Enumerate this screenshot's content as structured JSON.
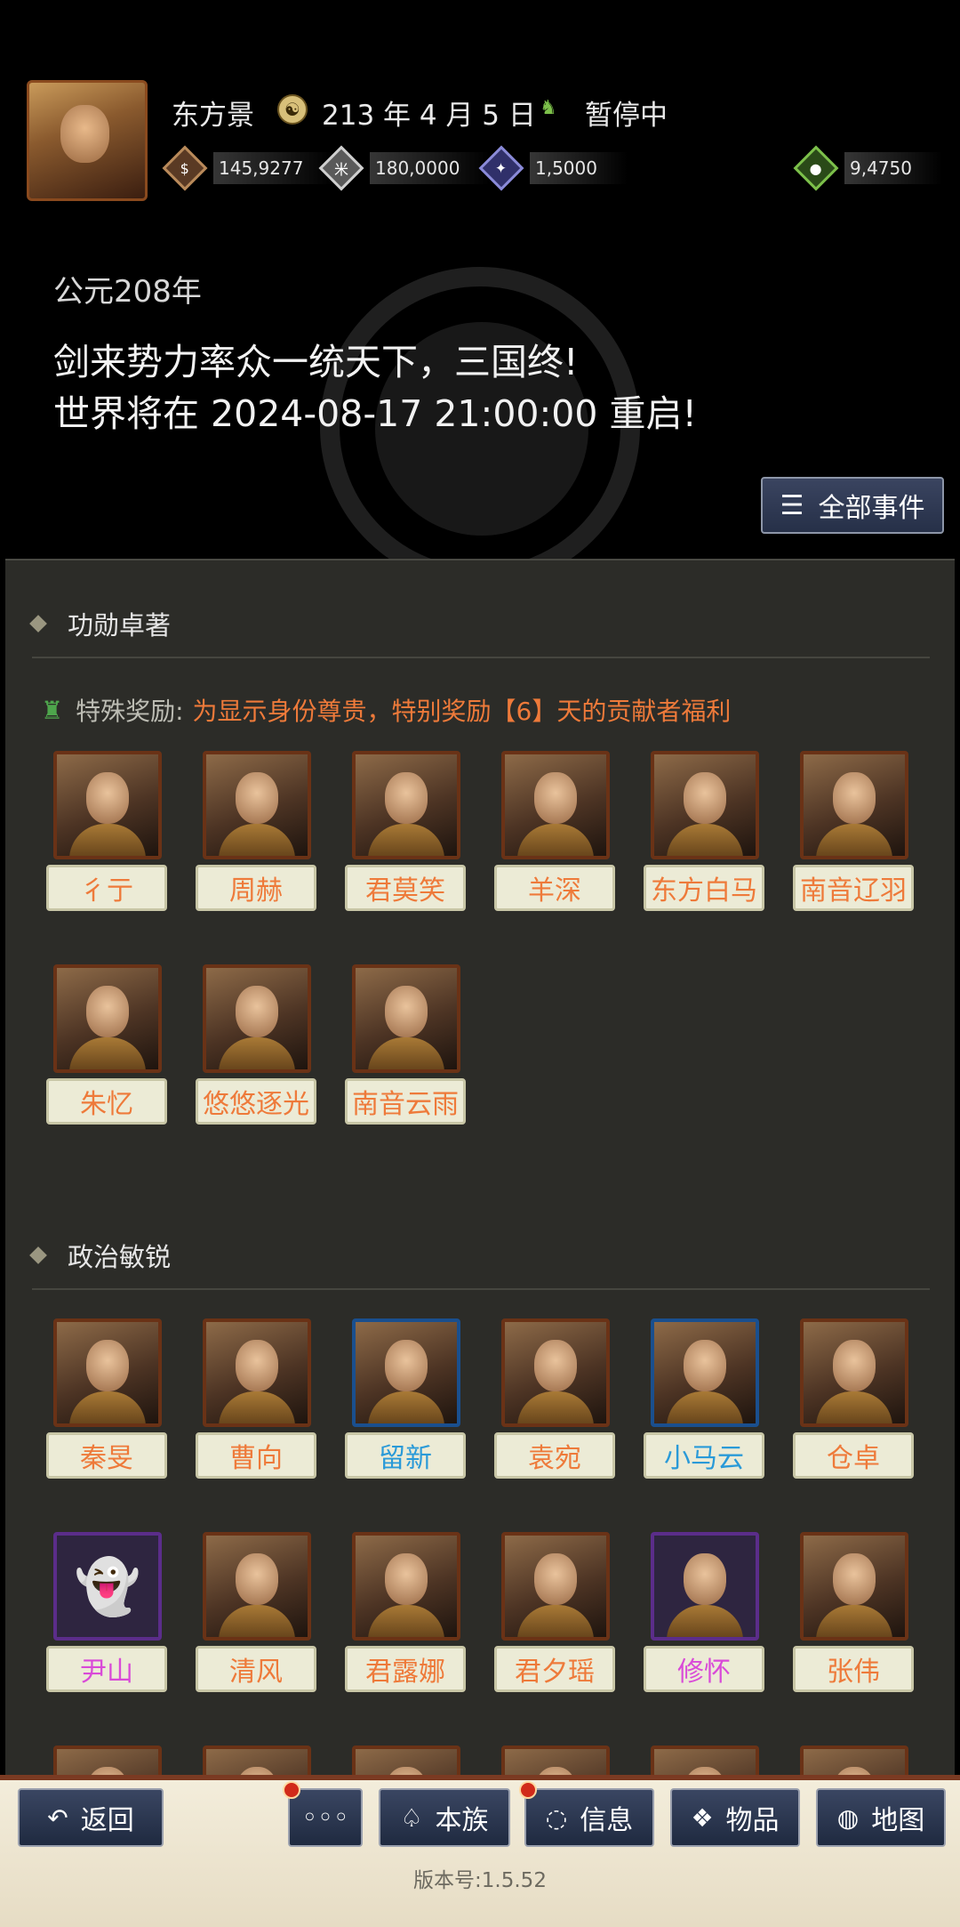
{
  "header": {
    "player_name": "东方景",
    "date": "213 年 4 月 5 日",
    "status": "暂停中",
    "resources": [
      {
        "icon": "coin-icon",
        "value": "145,9277"
      },
      {
        "icon": "grain-icon",
        "value": "180,0000"
      },
      {
        "icon": "soldier-icon",
        "value": "1,5000"
      },
      {
        "icon": "money-bag-icon",
        "value": "9,4750"
      }
    ]
  },
  "announcement": {
    "era": "公元208年",
    "line1": "剑来势力率众一统天下，三国终!",
    "line2": "世界将在 2024-08-17 21:00:00 重启!",
    "all_events": "全部事件"
  },
  "section1": {
    "title": "功勋卓著",
    "reward_label": "特殊奖励:",
    "reward_text": "为显示身份尊贵，特别奖励【6】天的贡献者福利",
    "generals": [
      "彳亍",
      "周赫",
      "君莫笑",
      "羊深",
      "东方白马",
      "南音辽羽",
      "朱忆",
      "悠悠逐光",
      "南音云雨"
    ]
  },
  "section2": {
    "title": "政治敏锐",
    "generals": [
      "秦旻",
      "曹向",
      "留新",
      "袁宛",
      "小马云",
      "仓卓",
      "尹山",
      "清风",
      "君露娜",
      "君夕瑶",
      "修怀",
      "张伟"
    ]
  },
  "colors": {
    "orange_name": "#ee7a3a",
    "blue_name": "#2a9ad8",
    "purple_name": "#d94ad8"
  },
  "bottom": {
    "back": "返回",
    "more": "◦◦◦",
    "clan": "本族",
    "info": "信息",
    "items": "物品",
    "map": "地图",
    "version": "版本号:1.5.52"
  }
}
